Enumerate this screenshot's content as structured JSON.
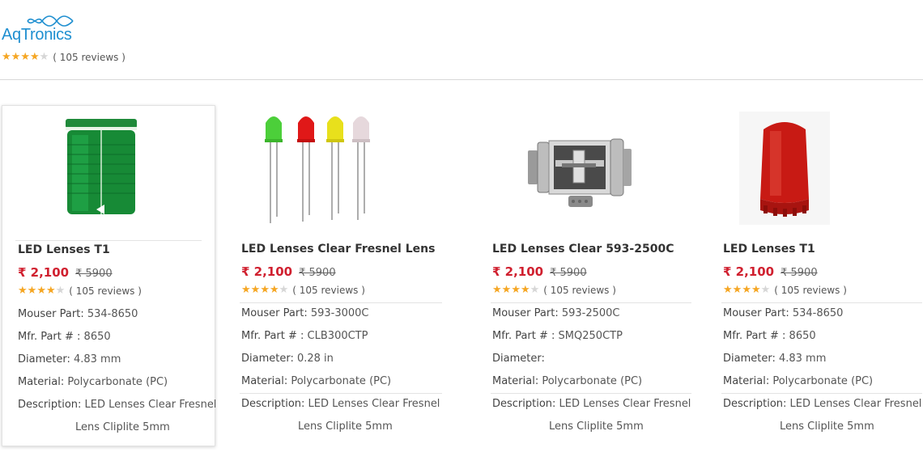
{
  "brand": {
    "name": "AqTronics",
    "rating_stars": 4,
    "reviews": "( 105 reviews )"
  },
  "colors": {
    "price": "#d0202f",
    "star": "#f5a623",
    "logo": "#1f8fd0"
  },
  "products": [
    {
      "image": "green-tower-light-lens",
      "title": "LED Lenses T1",
      "price": "₹ 2,100",
      "old_price": "₹ 5900",
      "rating_stars": 4,
      "reviews": "( 105 reviews )",
      "mouser_label": "Mouser Part:",
      "mouser_value": " 534-8650",
      "mfr_label": "Mfr. Part # :",
      "mfr_value": " 8650",
      "diameter_label": "Diameter:",
      "diameter_value": " 4.83 mm",
      "material_label": "Material:",
      "material_value": " Polycarbonate (PC)",
      "description_label": "Description:",
      "description_value": " LED Lenses Clear Fresnel",
      "description_line2": "Lens Cliplite 5mm"
    },
    {
      "image": "color-leds",
      "title": "LED Lenses Clear Fresnel Lens",
      "price": "₹ 2,100",
      "old_price": "₹ 5900",
      "rating_stars": 4,
      "reviews": "( 105 reviews )",
      "mouser_label": "Mouser Part:",
      "mouser_value": " 593-3000C",
      "mfr_label": "Mfr. Part # :",
      "mfr_value": " CLB300CTP",
      "diameter_label": "Diameter:",
      "diameter_value": " 0.28 in",
      "material_label": "Material:",
      "material_value": " Polycarbonate (PC)",
      "description_label": "Description:",
      "description_value": " LED Lenses Clear Fresnel",
      "description_line2": "Lens Cliplite 5mm"
    },
    {
      "image": "metal-reel-lens",
      "title": "LED Lenses Clear 593-2500C",
      "price": "₹ 2,100",
      "old_price": "₹ 5900",
      "rating_stars": 4,
      "reviews": "( 105 reviews )",
      "mouser_label": "Mouser Part:",
      "mouser_value": " 593-2500C",
      "mfr_label": "Mfr. Part # :",
      "mfr_value": " SMQ250CTP",
      "diameter_label": "Diameter:",
      "diameter_value": "",
      "material_label": "Material:",
      "material_value": " Polycarbonate (PC)",
      "description_label": "Description:",
      "description_value": " LED Lenses Clear Fresnel",
      "description_line2": "Lens Cliplite 5mm"
    },
    {
      "image": "red-lens-cap",
      "title": "LED Lenses T1",
      "price": "₹ 2,100",
      "old_price": "₹ 5900",
      "rating_stars": 4,
      "reviews": "( 105 reviews )",
      "mouser_label": "Mouser Part:",
      "mouser_value": " 534-8650",
      "mfr_label": "Mfr. Part # :",
      "mfr_value": " 8650",
      "diameter_label": "Diameter:",
      "diameter_value": " 4.83 mm",
      "material_label": "Material:",
      "material_value": " Polycarbonate (PC)",
      "description_label": "Description:",
      "description_value": " LED Lenses Clear Fresnel",
      "description_line2": "Lens Cliplite 5mm"
    }
  ]
}
